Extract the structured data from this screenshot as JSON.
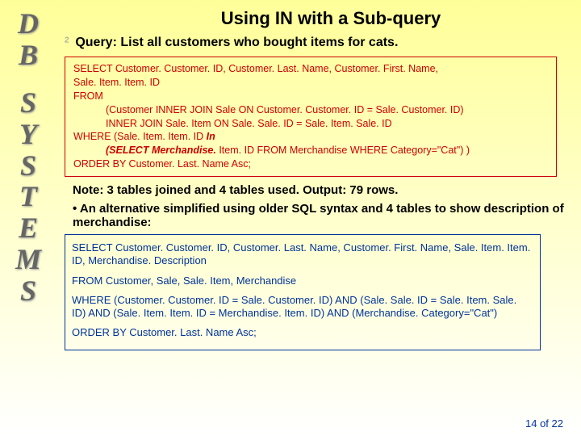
{
  "sidebar": {
    "letters": [
      "D",
      "B",
      "S",
      "Y",
      "S",
      "T",
      "E",
      "M",
      "S"
    ]
  },
  "title": "Using IN with a Sub-query",
  "bullet_glyph": "²",
  "query_desc": "Query: List all customers who bought items for cats.",
  "code1": {
    "l1": "SELECT Customer. Customer. ID, Customer. Last. Name, Customer. First. Name,",
    "l2": "Sale. Item. Item. ID",
    "l3": "FROM",
    "l4": "(Customer INNER JOIN Sale ON Customer. Customer. ID = Sale. Customer. ID)",
    "l5": "INNER JOIN Sale. Item ON Sale. Sale. ID = Sale. Item. Sale. ID",
    "l6a": "WHERE (Sale. Item. Item. ID ",
    "l6b": "In",
    "l7a": "(SELECT Merchandise. ",
    "l7b": "Item. ID FROM Merchandise WHERE Category=\"Cat\") )",
    "l8": "ORDER BY Customer. Last. Name Asc;"
  },
  "note": "Note: 3 tables joined and 4 tables used. Output: 79 rows.",
  "alt": "• An alternative simplified using older SQL syntax and 4 tables to show description of merchandise:",
  "code2": {
    "p1": "SELECT Customer. Customer. ID, Customer. Last. Name, Customer. First. Name, Sale. Item. Item. ID, Merchandise. Description",
    "p2": "FROM Customer, Sale, Sale. Item, Merchandise",
    "p3": "WHERE (Customer. Customer. ID = Sale. Customer. ID) AND (Sale. Sale. ID = Sale. Item. Sale. ID) AND (Sale. Item. Item. ID = Merchandise. Item. ID) AND (Merchandise. Category=\"Cat\")",
    "p4": "ORDER BY Customer. Last. Name  Asc;"
  },
  "footer": {
    "page": "14",
    "of": " of ",
    "total": "22"
  }
}
